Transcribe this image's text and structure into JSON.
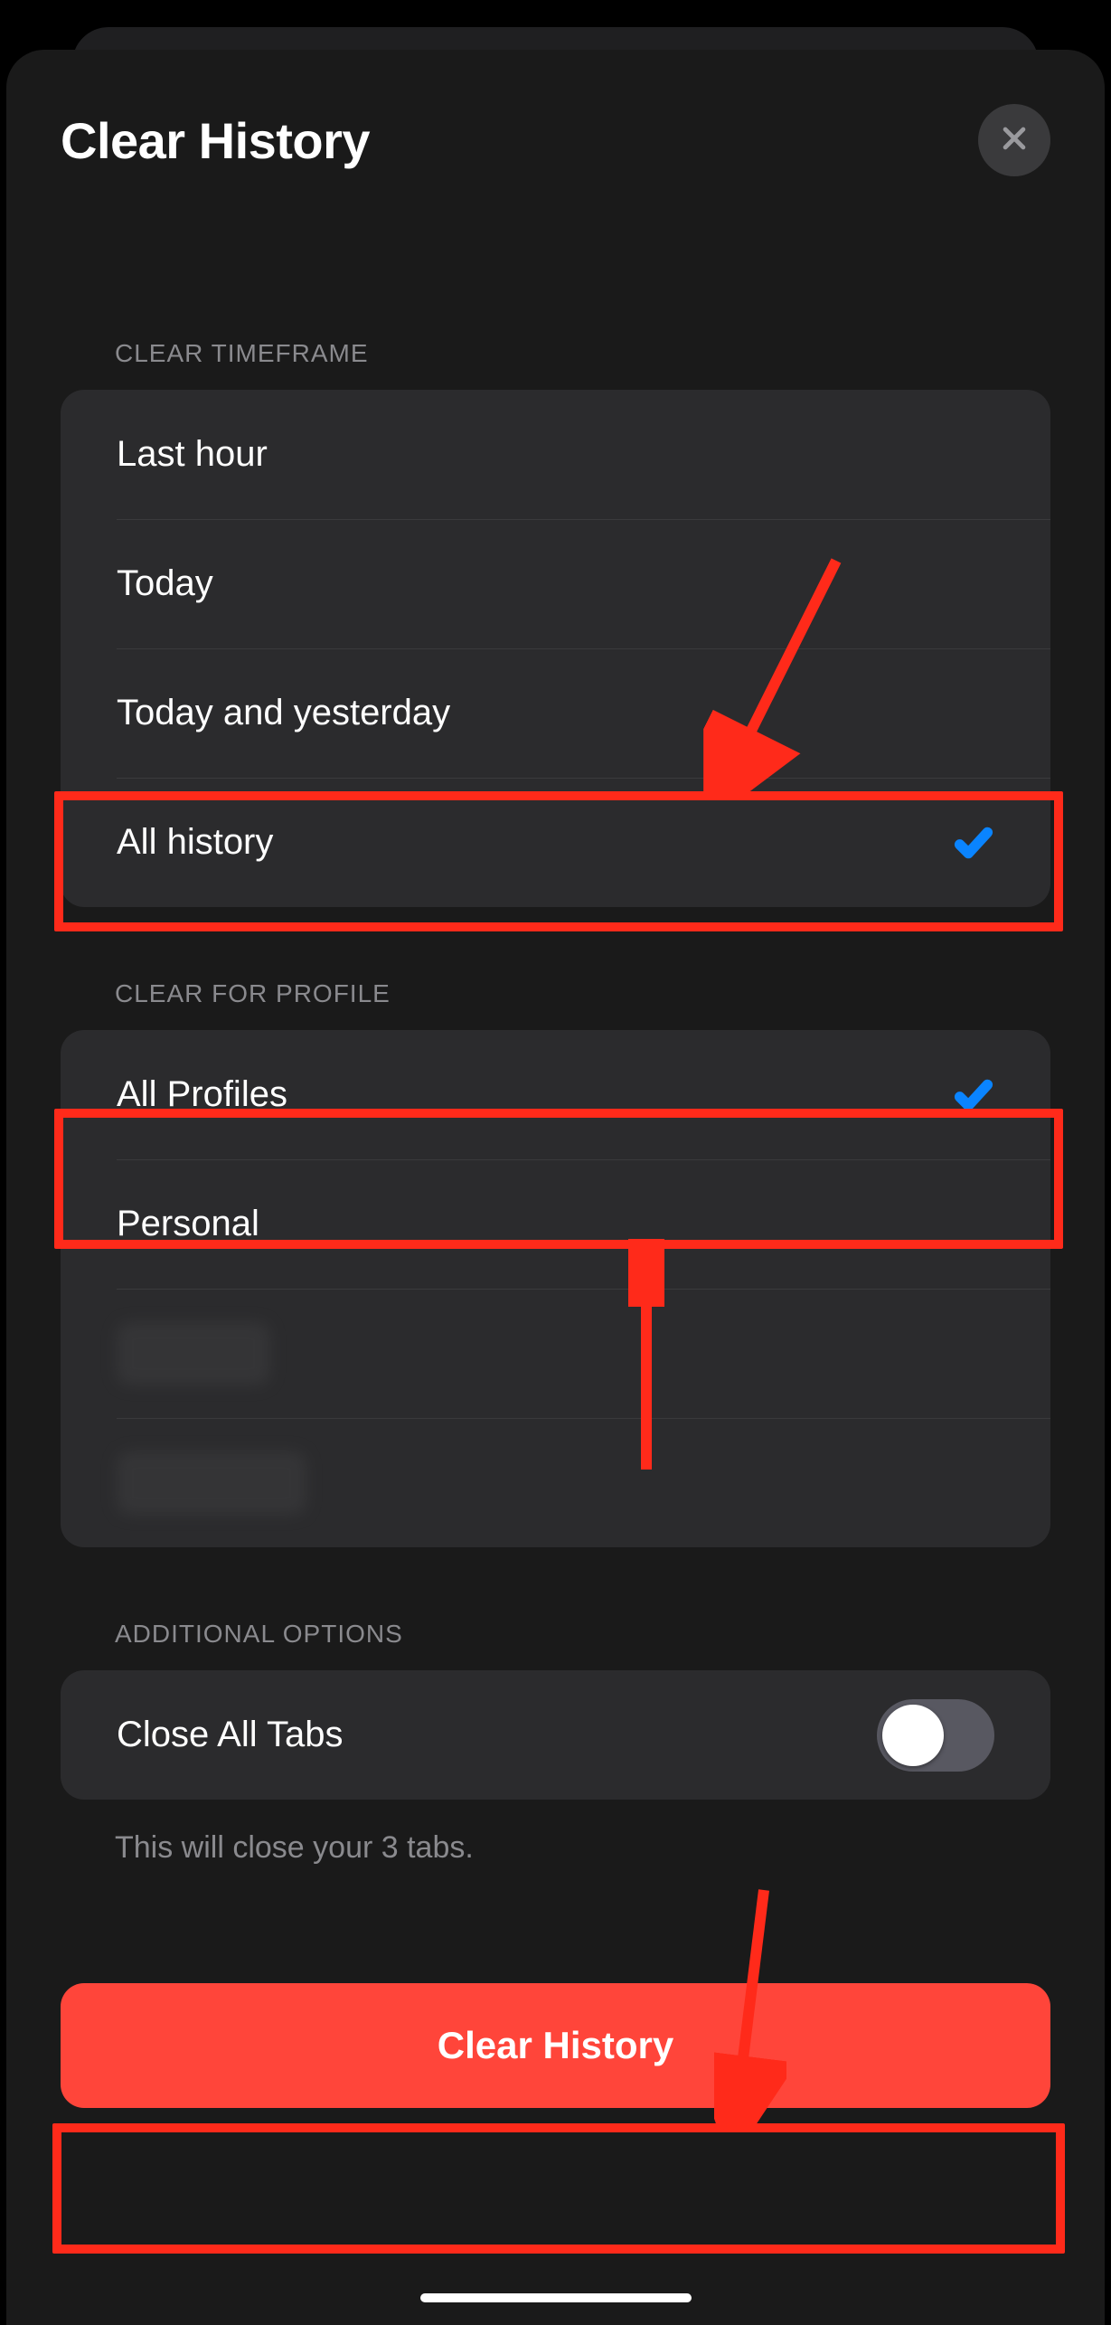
{
  "header": {
    "title": "Clear History"
  },
  "sections": {
    "timeframe": {
      "label": "Clear Timeframe",
      "options": {
        "last_hour": "Last hour",
        "today": "Today",
        "today_yesterday": "Today and yesterday",
        "all_history": "All history"
      },
      "selected": "all_history"
    },
    "profile": {
      "label": "Clear for Profile",
      "options": {
        "all_profiles": "All Profiles",
        "personal": "Personal"
      },
      "selected": "all_profiles"
    },
    "additional": {
      "label": "Additional Options",
      "close_all_tabs": "Close All Tabs",
      "close_all_tabs_on": false,
      "footer": "This will close your 3 tabs."
    }
  },
  "action": {
    "clear_history": "Clear History"
  },
  "annotations": {
    "highlight_color": "#ff2a1a",
    "highlights": [
      "timeframe.all_history",
      "profile.all_profiles",
      "action.clear_history"
    ],
    "arrows": [
      {
        "from": "upper-right",
        "to": "timeframe.all_history"
      },
      {
        "from": "below",
        "to": "profile.all_profiles"
      },
      {
        "from": "above",
        "to": "action.clear_history"
      }
    ]
  },
  "colors": {
    "accent": "#0a84ff",
    "destructive": "#ff453a"
  }
}
